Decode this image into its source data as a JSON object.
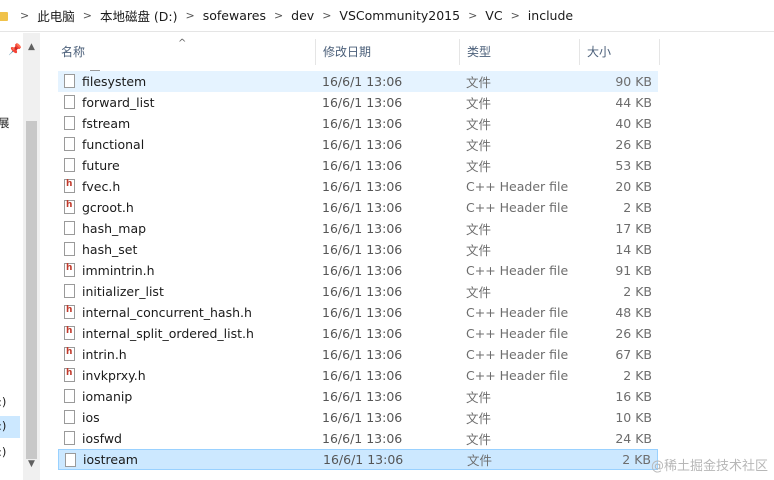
{
  "address": {
    "crumbs": [
      "此电脑",
      "本地磁盘 (D:)",
      "sofewares",
      "dev",
      "VSCommunity2015",
      "VC",
      "include"
    ],
    "separator": ">"
  },
  "nav": {
    "text1": "展",
    "text2": ":)",
    "text3": ":)",
    "text4": ":)"
  },
  "columns": {
    "name": "名称",
    "date": "修改日期",
    "type": "类型",
    "size": "大小"
  },
  "files": [
    {
      "name": "filesystem",
      "date": "16/6/1 13:06",
      "type": "文件",
      "size": "90 KB",
      "icon": "file-icon",
      "state": "hover"
    },
    {
      "name": "forward_list",
      "date": "16/6/1 13:06",
      "type": "文件",
      "size": "44 KB",
      "icon": "file-icon"
    },
    {
      "name": "fstream",
      "date": "16/6/1 13:06",
      "type": "文件",
      "size": "40 KB",
      "icon": "file-icon"
    },
    {
      "name": "functional",
      "date": "16/6/1 13:06",
      "type": "文件",
      "size": "26 KB",
      "icon": "file-icon"
    },
    {
      "name": "future",
      "date": "16/6/1 13:06",
      "type": "文件",
      "size": "53 KB",
      "icon": "file-icon"
    },
    {
      "name": "fvec.h",
      "date": "16/6/1 13:06",
      "type": "C++ Header file",
      "size": "20 KB",
      "icon": "header-file-icon"
    },
    {
      "name": "gcroot.h",
      "date": "16/6/1 13:06",
      "type": "C++ Header file",
      "size": "2 KB",
      "icon": "header-file-icon"
    },
    {
      "name": "hash_map",
      "date": "16/6/1 13:06",
      "type": "文件",
      "size": "17 KB",
      "icon": "file-icon"
    },
    {
      "name": "hash_set",
      "date": "16/6/1 13:06",
      "type": "文件",
      "size": "14 KB",
      "icon": "file-icon"
    },
    {
      "name": "immintrin.h",
      "date": "16/6/1 13:06",
      "type": "C++ Header file",
      "size": "91 KB",
      "icon": "header-file-icon"
    },
    {
      "name": "initializer_list",
      "date": "16/6/1 13:06",
      "type": "文件",
      "size": "2 KB",
      "icon": "file-icon"
    },
    {
      "name": "internal_concurrent_hash.h",
      "date": "16/6/1 13:06",
      "type": "C++ Header file",
      "size": "48 KB",
      "icon": "header-file-icon"
    },
    {
      "name": "internal_split_ordered_list.h",
      "date": "16/6/1 13:06",
      "type": "C++ Header file",
      "size": "26 KB",
      "icon": "header-file-icon"
    },
    {
      "name": "intrin.h",
      "date": "16/6/1 13:06",
      "type": "C++ Header file",
      "size": "67 KB",
      "icon": "header-file-icon"
    },
    {
      "name": "invkprxy.h",
      "date": "16/6/1 13:06",
      "type": "C++ Header file",
      "size": "2 KB",
      "icon": "header-file-icon"
    },
    {
      "name": "iomanip",
      "date": "16/6/1 13:06",
      "type": "文件",
      "size": "16 KB",
      "icon": "file-icon"
    },
    {
      "name": "ios",
      "date": "16/6/1 13:06",
      "type": "文件",
      "size": "10 KB",
      "icon": "file-icon"
    },
    {
      "name": "iosfwd",
      "date": "16/6/1 13:06",
      "type": "文件",
      "size": "24 KB",
      "icon": "file-icon"
    },
    {
      "name": "iostream",
      "date": "16/6/1 13:06",
      "type": "文件",
      "size": "2 KB",
      "icon": "file-icon",
      "state": "selected"
    }
  ],
  "watermark": "@稀土掘金技术社区",
  "colors": {
    "hover": "#e5f3ff",
    "selected": "#cce8ff",
    "header_text": "#4c607a"
  }
}
